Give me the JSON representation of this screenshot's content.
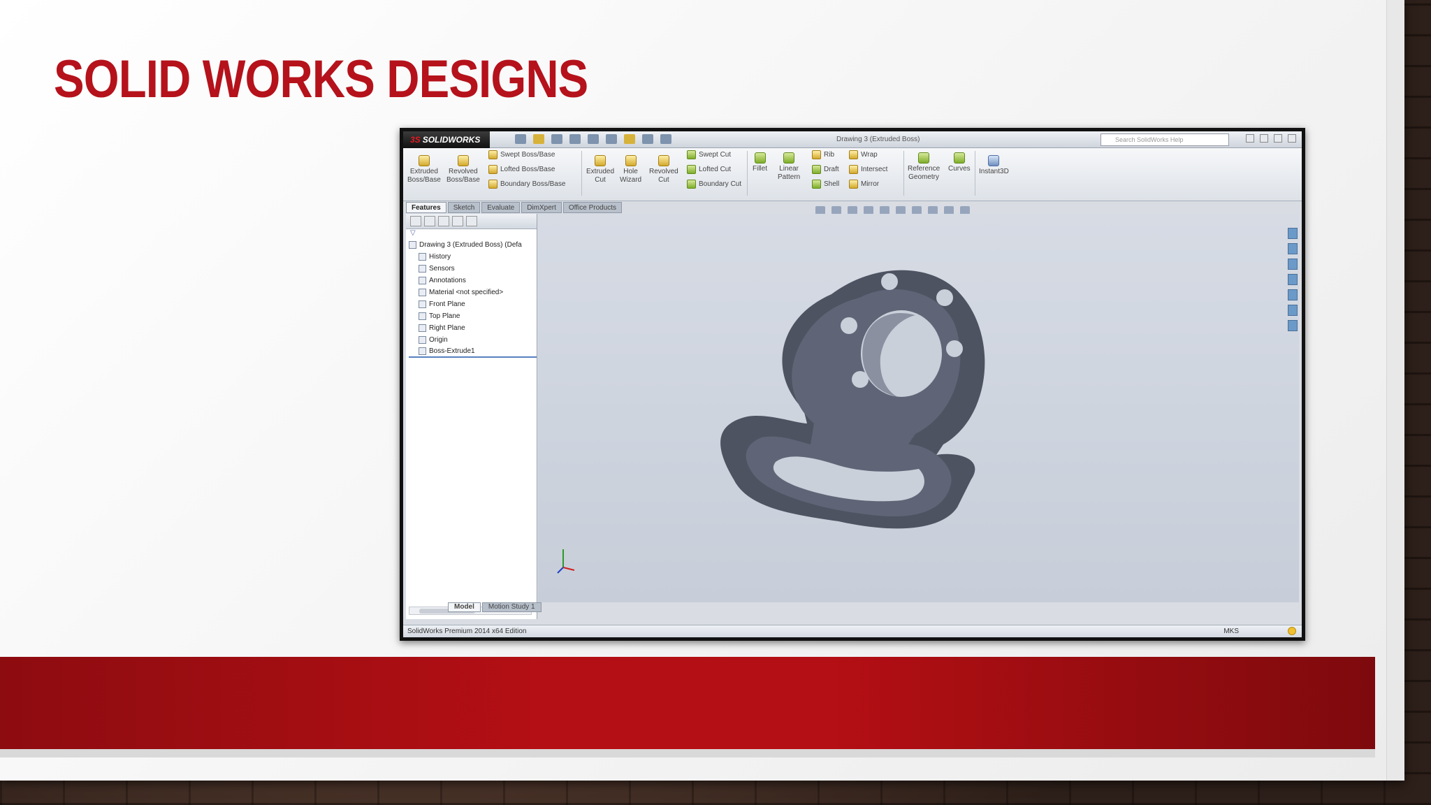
{
  "slide": {
    "title": "SOLID WORKS DESIGNS",
    "accent_color": "#b5121b",
    "band_color": "#b40f14"
  },
  "app": {
    "brand_mark": "3S",
    "brand_name": "SOLIDWORKS",
    "window_title": "Drawing 3 (Extruded Boss)",
    "search_placeholder": "Search SolidWorks Help"
  },
  "ribbon": {
    "extruded_boss": [
      "Extruded",
      "Boss/Base"
    ],
    "revolved_boss": [
      "Revolved",
      "Boss/Base"
    ],
    "swept_boss": "Swept Boss/Base",
    "lofted_boss": "Lofted Boss/Base",
    "boundary_boss": "Boundary Boss/Base",
    "extruded_cut": [
      "Extruded",
      "Cut"
    ],
    "hole_wizard": [
      "Hole",
      "Wizard"
    ],
    "revolved_cut": [
      "Revolved",
      "Cut"
    ],
    "swept_cut": "Swept Cut",
    "lofted_cut": "Lofted Cut",
    "boundary_cut": "Boundary Cut",
    "fillet": "Fillet",
    "linear_pattern": [
      "Linear",
      "Pattern"
    ],
    "rib": "Rib",
    "draft": "Draft",
    "shell": "Shell",
    "wrap": "Wrap",
    "intersect": "Intersect",
    "mirror": "Mirror",
    "reference_geometry": [
      "Reference",
      "Geometry"
    ],
    "curves": "Curves",
    "instant3d": "Instant3D"
  },
  "tabs": [
    "Features",
    "Sketch",
    "Evaluate",
    "DimXpert",
    "Office Products"
  ],
  "tree": {
    "root": "Drawing 3 (Extruded Boss)  (Defa",
    "items": [
      "History",
      "Sensors",
      "Annotations",
      "Material <not specified>",
      "Front Plane",
      "Top Plane",
      "Right Plane",
      "Origin",
      "Boss-Extrude1"
    ]
  },
  "bottom_tabs": [
    "Model",
    "Motion Study 1"
  ],
  "status": {
    "edition": "SolidWorks Premium 2014 x64 Edition",
    "units": "MKS"
  },
  "part": {
    "body_color": "#5a5f6e",
    "face_color": "#6e7485",
    "bolt_holes": 6
  }
}
